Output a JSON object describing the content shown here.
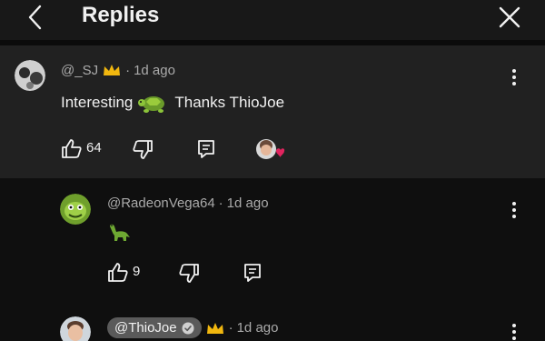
{
  "header": {
    "title": "Replies"
  },
  "comments": [
    {
      "author": "@_SJ",
      "time": "1d ago",
      "text_before": "Interesting",
      "text_after": "Thanks ThioJoe",
      "likes": "64"
    },
    {
      "author": "@RadeonVega64",
      "time": "1d ago",
      "likes": "9"
    },
    {
      "author": "@ThioJoe",
      "time": "1d ago"
    }
  ],
  "separator": "·",
  "colors": {
    "background": "#0f0f0f",
    "highlight": "#212121",
    "heart": "#e0245e",
    "crown": "#f1b70f"
  }
}
